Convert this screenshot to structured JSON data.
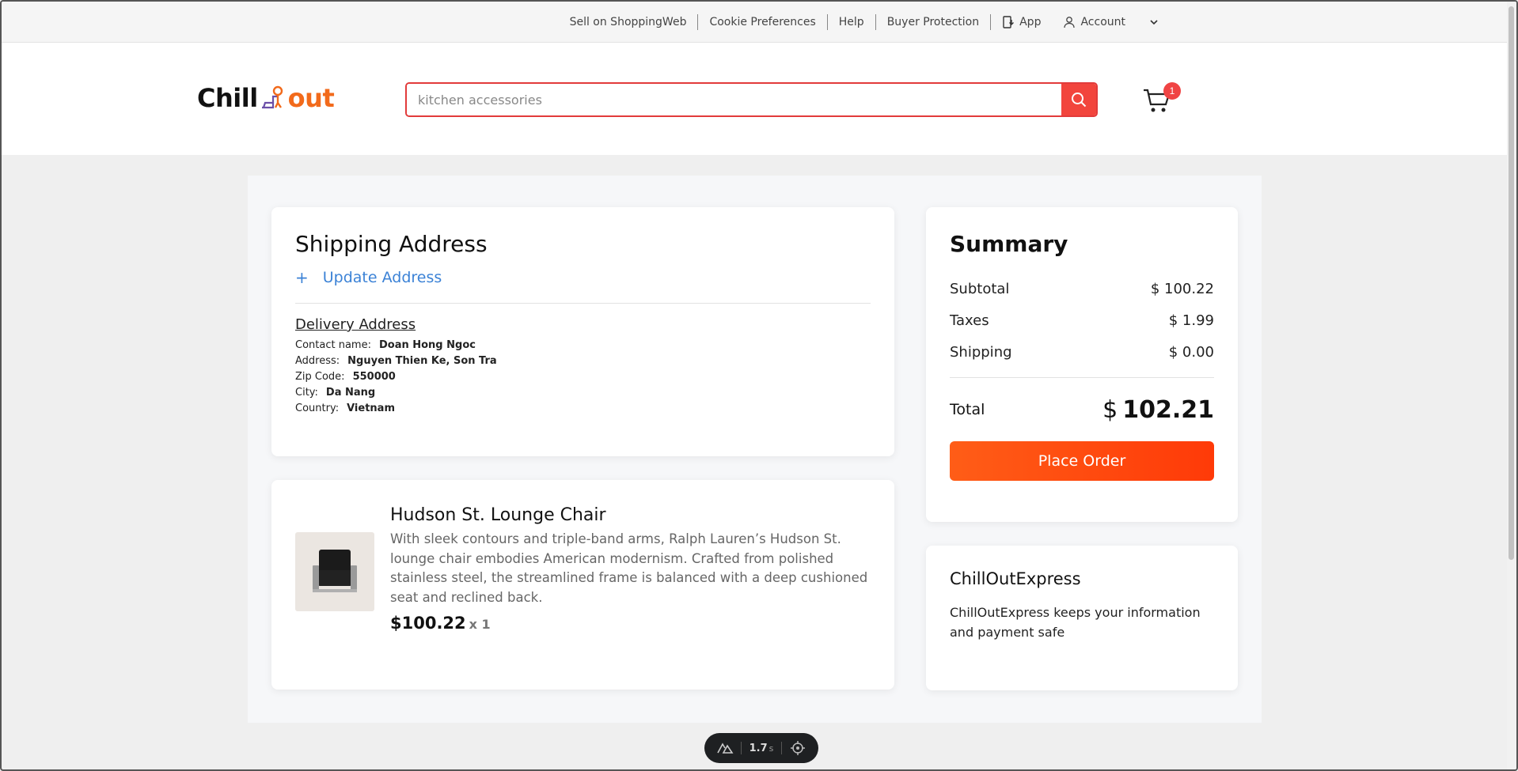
{
  "topbar": {
    "links": [
      "Sell on ShoppingWeb",
      "Cookie Preferences",
      "Help",
      "Buyer Protection"
    ],
    "app_label": "App",
    "account_label": "Account"
  },
  "header": {
    "logo": {
      "part1": "Chill",
      "part2": "out"
    },
    "search": {
      "value": "",
      "placeholder": "kitchen accessories"
    },
    "cart_count": "1"
  },
  "shipping": {
    "title": "Shipping Address",
    "update_plus": "+",
    "update_label": "Update Address",
    "delivery_title": "Delivery Address",
    "fields": [
      {
        "label": "Contact name:",
        "value": "Doan Hong Ngoc"
      },
      {
        "label": "Address:",
        "value": "Nguyen Thien Ke, Son Tra"
      },
      {
        "label": "Zip Code:",
        "value": "550000"
      },
      {
        "label": "City:",
        "value": "Da Nang"
      },
      {
        "label": "Country:",
        "value": "Vietnam"
      }
    ]
  },
  "item": {
    "name": "Hudson St. Lounge Chair",
    "description": "With sleek contours and triple-band arms, Ralph Lauren’s Hudson St. lounge chair embodies American modernism. Crafted from polished stainless steel, the streamlined frame is balanced with a deep cushioned seat and reclined back.",
    "price": "$100.22",
    "quantity": "x 1"
  },
  "summary": {
    "title": "Summary",
    "lines": [
      {
        "label": "Subtotal",
        "value": "$ 100.22"
      },
      {
        "label": "Taxes",
        "value": "$ 1.99"
      },
      {
        "label": "Shipping",
        "value": "$ 0.00"
      }
    ],
    "total_label": "Total",
    "total_currency": "$",
    "total_value": "102.21",
    "place_order": "Place Order"
  },
  "express": {
    "title": "ChillOutExpress",
    "text": "ChillOutExpress keeps your information and payment safe"
  },
  "devtools": {
    "time": "1.7",
    "unit": "s"
  },
  "colors": {
    "accent": "#f26a1b",
    "search_border": "#e23b3b",
    "link": "#3b82d6",
    "order_button": "#ff4a10"
  }
}
